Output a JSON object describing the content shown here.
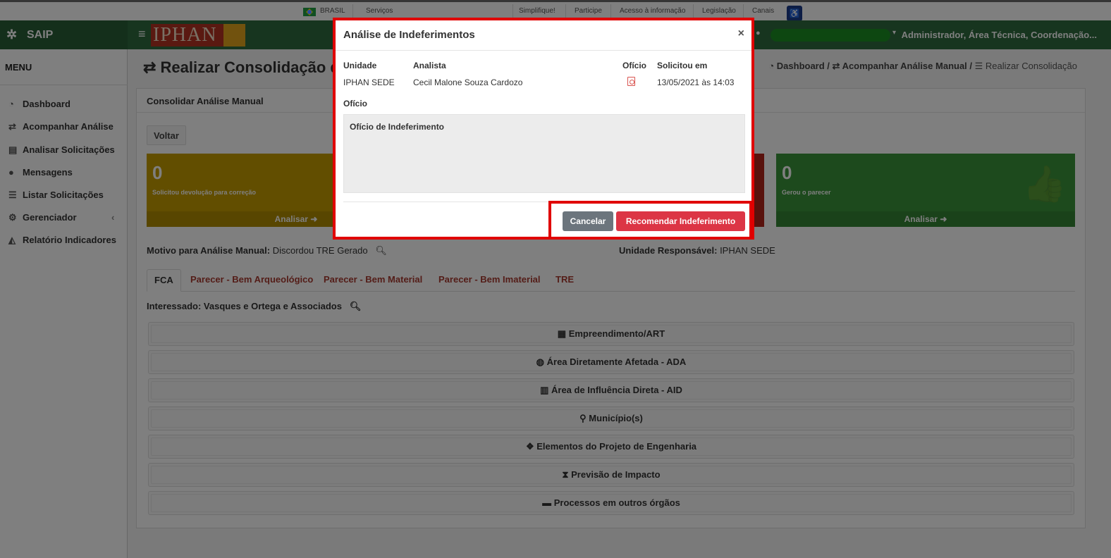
{
  "govbar": {
    "country": "BRASIL",
    "links": [
      "Serviços",
      "Simplifique!",
      "Participe",
      "Acesso à informação",
      "Legislação",
      "Canais"
    ]
  },
  "header": {
    "app_name": "SAIP",
    "brand": "IPHAN",
    "user": "Administrador, Área Técnica, Coordenação..."
  },
  "sidebar": {
    "menu_title": "MENU",
    "items": [
      {
        "label": "Dashboard",
        "icon": "dashboard-icon"
      },
      {
        "label": "Acompanhar Análise",
        "icon": "exchange-icon"
      },
      {
        "label": "Analisar Solicitações",
        "icon": "book-icon"
      },
      {
        "label": "Mensagens",
        "icon": "comments-icon"
      },
      {
        "label": "Listar Solicitações",
        "icon": "list-icon"
      },
      {
        "label": "Gerenciador",
        "icon": "cogs-icon"
      },
      {
        "label": "Relatório Indicadores",
        "icon": "area-chart-icon"
      }
    ]
  },
  "page": {
    "title": "Realizar Consolidação d",
    "breadcrumb": [
      "Dashboard",
      "Acompanhar Análise Manual",
      "Realizar Consolidação"
    ],
    "box_title": "Consolidar Análise Manual",
    "back_button": "Voltar",
    "stat_boxes": [
      {
        "value": "0",
        "label": "Solicitou devolução para correção",
        "footer": "Analisar",
        "color": "#c59c00"
      },
      {
        "value": "0",
        "label": "Gerou o parecer",
        "footer": "Analisar",
        "color": "#3a953a"
      }
    ],
    "motivo_label": "Motivo para Análise Manual:",
    "motivo_value": "Discordou TRE Gerado",
    "unidade_label": "Unidade Responsável:",
    "unidade_value": "IPHAN SEDE",
    "tabs": [
      "FCA",
      "Parecer - Bem Arqueológico",
      "Parecer - Bem Material",
      "Parecer - Bem Imaterial",
      "TRE"
    ],
    "interessado": "Interessado: Vasques e Ortega e Associados",
    "sections": [
      {
        "label": "Empreendimento/ART",
        "icon": "building-icon"
      },
      {
        "label": "Área Diretamente Afetada - ADA",
        "icon": "globe-icon"
      },
      {
        "label": "Área de Influência Direta - AID",
        "icon": "map-icon"
      },
      {
        "label": "Município(s)",
        "icon": "map-marker-icon"
      },
      {
        "label": "Elementos do Projeto de Engenharia",
        "icon": "cubes-icon"
      },
      {
        "label": "Previsão de Impacto",
        "icon": "hourglass-icon"
      },
      {
        "label": "Processos em outros órgãos",
        "icon": "archive-icon"
      }
    ]
  },
  "modal": {
    "title": "Análise de Indeferimentos",
    "close": "×",
    "headers": {
      "unidade": "Unidade",
      "analista": "Analista",
      "oficio": "Ofício",
      "solicitou": "Solicitou em"
    },
    "row": {
      "unidade": "IPHAN SEDE",
      "analista": "Cecil Malone Souza Cardozo",
      "solicitou": "13/05/2021 às 14:03"
    },
    "oficio_label": "Ofício",
    "oficio_text": "Ofício de Indeferimento",
    "cancel": "Cancelar",
    "confirm": "Recomendar Indeferimento"
  }
}
